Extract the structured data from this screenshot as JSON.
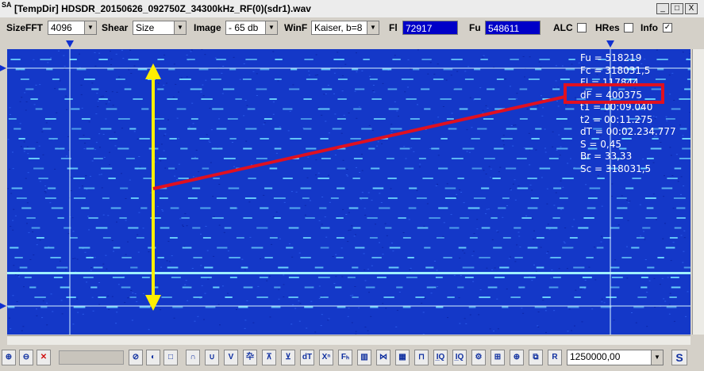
{
  "window": {
    "icon_text": "SA",
    "title": "[TempDir] HDSDR_20150626_092750Z_34300kHz_RF(0)(sdr1).wav",
    "minimize": "_",
    "maximize": "□",
    "close": "X"
  },
  "toolbar": {
    "sizefft_label": "SizeFFT",
    "sizefft_value": "4096",
    "shear_label": "Shear",
    "shear_value": "Size",
    "image_label": "Image",
    "image_value": "- 65 db",
    "winf_label": "WinF",
    "winf_value": "Kaiser, b=8",
    "fl_label": "Fl",
    "fl_value": "72917",
    "fu_label": "Fu",
    "fu_value": "548611",
    "alc_label": "ALC",
    "hres_label": "HRes",
    "info_label": "Info",
    "info_checked": "✓"
  },
  "measurements": {
    "lines": [
      "Fu = 518219",
      "Fc = 318031,5",
      "Fl = 117844",
      "dF = 400375",
      "t1 = 00:09.040",
      "t2 = 00:11.275",
      "dT = 00:02.234.777",
      "S = 0,45",
      "Br = 33,33",
      "Sc = 318031,5"
    ]
  },
  "bottom": {
    "icons": [
      "⊕",
      "⊖",
      "✕",
      "",
      "⊘",
      "◐",
      "□",
      "∩",
      "∪",
      "V",
      "卆",
      "⊼",
      "⊻",
      "dT",
      "Xⁿ",
      "Fₕ",
      "▥",
      "⋈",
      "▦",
      "⊓",
      "I̲Q",
      "I̲Q",
      "⚙",
      "⊞",
      "⊕",
      "⧉",
      "R"
    ],
    "frequency_value": "1250000,00",
    "s_label": "S"
  },
  "colors": {
    "spectrogram_bg": "#1438c8",
    "signal": "#6fd9ff",
    "annotation_red": "#e01020",
    "annotation_yellow": "#ffee00"
  }
}
